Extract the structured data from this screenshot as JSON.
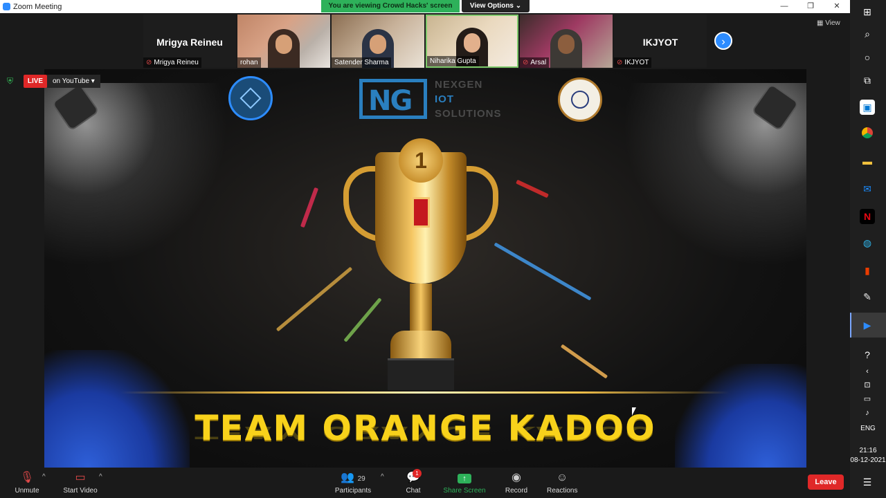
{
  "window": {
    "title": "Zoom Meeting",
    "minimize": "—",
    "restore": "❐",
    "close": "✕"
  },
  "share_banner": {
    "text": "You are viewing Crowd Hacks' screen",
    "view_options": "View Options ⌄"
  },
  "view_button": "▦ View",
  "participants_strip": [
    {
      "big_name": "Mrigya Reineu",
      "label": "Mrigya Reineu",
      "muted": true,
      "video": false
    },
    {
      "label": "rohan",
      "muted": false,
      "video": true
    },
    {
      "label": "Satender Sharma",
      "muted": false,
      "video": true
    },
    {
      "label": "Niharika Gupta",
      "muted": false,
      "video": true
    },
    {
      "label": "Arsal",
      "muted": true,
      "video": true
    },
    {
      "big_name": "IKJYOT",
      "label": "IKJYOT",
      "muted": true,
      "video": false
    }
  ],
  "live": {
    "badge": "LIVE",
    "platform": "on YouTube ▾"
  },
  "shared_screen": {
    "company_line1": "NEXGEN",
    "company_line2": "IOT",
    "company_line3": "SOLUTIONS",
    "logo_letters": "NG",
    "medal_number": "1",
    "team_title": "TEAM ORANGE KADOO"
  },
  "toolbar": {
    "unmute": "Unmute",
    "start_video": "Start Video",
    "participants": "Participants",
    "participants_count": "29",
    "chat": "Chat",
    "chat_badge": "1",
    "share_screen": "Share Screen",
    "record": "Record",
    "reactions": "Reactions",
    "leave": "Leave"
  },
  "system_tray": {
    "language": "ENG",
    "time": "21:16",
    "date": "08-12-2021"
  },
  "colors": {
    "zoom_blue": "#2d8cff",
    "share_green": "#2eb15a",
    "leave_red": "#e02828",
    "title_gold": "#f8d21b"
  }
}
